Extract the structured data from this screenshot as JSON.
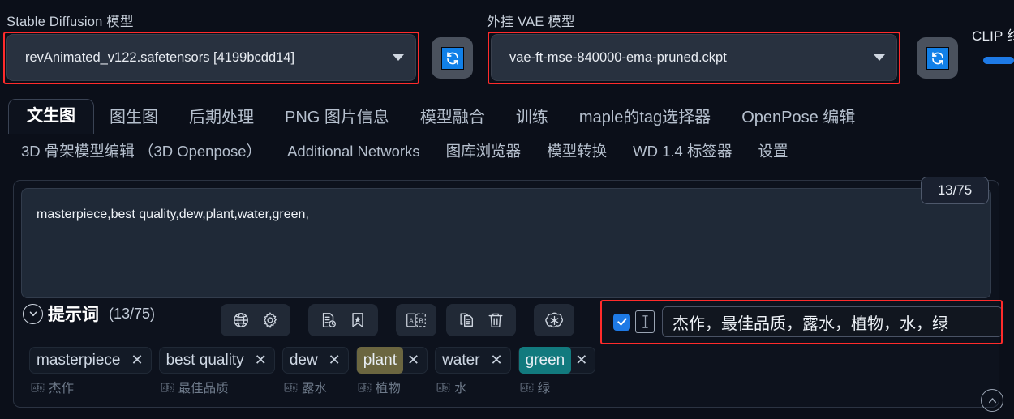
{
  "models": {
    "sd_label": "Stable Diffusion 模型",
    "sd_value": "revAnimated_v122.safetensors [4199bcdd14]",
    "vae_label": "外挂 VAE 模型",
    "vae_value": "vae-ft-mse-840000-ema-pruned.ckpt",
    "clip_label": "CLIP 终",
    "refresh_icon": "refresh-icon",
    "caret_icon": "chevron-down-icon",
    "highlight_color": "#ff2b2b",
    "accent_color": "#1e7ae6"
  },
  "tabs": {
    "row1": [
      {
        "label": "文生图",
        "active": true
      },
      {
        "label": "图生图",
        "active": false
      },
      {
        "label": "后期处理",
        "active": false
      },
      {
        "label": "PNG 图片信息",
        "active": false
      },
      {
        "label": "模型融合",
        "active": false
      },
      {
        "label": "训练",
        "active": false
      },
      {
        "label": "maple的tag选择器",
        "active": false
      },
      {
        "label": "OpenPose 编辑",
        "active": false
      }
    ],
    "row2": [
      {
        "label": "3D 骨架模型编辑 （3D Openpose）",
        "active": false
      },
      {
        "label": "Additional Networks",
        "active": false
      },
      {
        "label": "图库浏览器",
        "active": false
      },
      {
        "label": "模型转换",
        "active": false
      },
      {
        "label": "WD 1.4 标签器",
        "active": false
      },
      {
        "label": "设置",
        "active": false
      }
    ]
  },
  "prompt": {
    "text": "masterpiece,best quality,dew,plant,water,green,",
    "placeholder": "提示词",
    "counter_badge": "13/75",
    "section_title": "提示词",
    "section_count": "(13/75)",
    "collapse_icon": "chevron-down-circle-icon"
  },
  "toolbar_groups": [
    {
      "name": "group-translate-settings",
      "icons": [
        {
          "name": "globe-icon",
          "title": "翻译"
        },
        {
          "name": "gear-icon",
          "title": "设置"
        }
      ]
    },
    {
      "name": "group-history-favorites",
      "icons": [
        {
          "name": "document-clock-icon",
          "title": "历史"
        },
        {
          "name": "bookmark-star-icon",
          "title": "收藏"
        }
      ]
    },
    {
      "name": "group-ab-compare",
      "icons": [
        {
          "name": "ab-compare-icon",
          "title": "A|B"
        }
      ]
    },
    {
      "name": "group-copy-delete",
      "icons": [
        {
          "name": "copy-icon",
          "title": "复制"
        },
        {
          "name": "trash-icon",
          "title": "删除"
        }
      ]
    },
    {
      "name": "group-openai",
      "icons": [
        {
          "name": "openai-icon",
          "title": "OpenAI"
        }
      ]
    }
  ],
  "translation": {
    "checkbox_checked": true,
    "checkbox_icon": "check-icon",
    "ibeam_icon": "text-cursor-icon",
    "value": "杰作，最佳品质，露水，植物，水，绿"
  },
  "chips": [
    {
      "label": "masterpiece",
      "sub": "杰作",
      "highlight": "none",
      "remove_icon": "close-icon"
    },
    {
      "label": "best quality",
      "sub": "最佳品质",
      "highlight": "none",
      "remove_icon": "close-icon"
    },
    {
      "label": "dew",
      "sub": "露水",
      "highlight": "none",
      "remove_icon": "close-icon"
    },
    {
      "label": "plant",
      "sub": "植物",
      "highlight": "#6b6640",
      "remove_icon": "close-icon"
    },
    {
      "label": "water",
      "sub": "水",
      "highlight": "none",
      "remove_icon": "close-icon"
    },
    {
      "label": "green",
      "sub": "绿",
      "highlight": "#127a7e",
      "remove_icon": "close-icon"
    }
  ],
  "footer": {
    "collapse_icon": "chevron-up-circle-icon"
  }
}
